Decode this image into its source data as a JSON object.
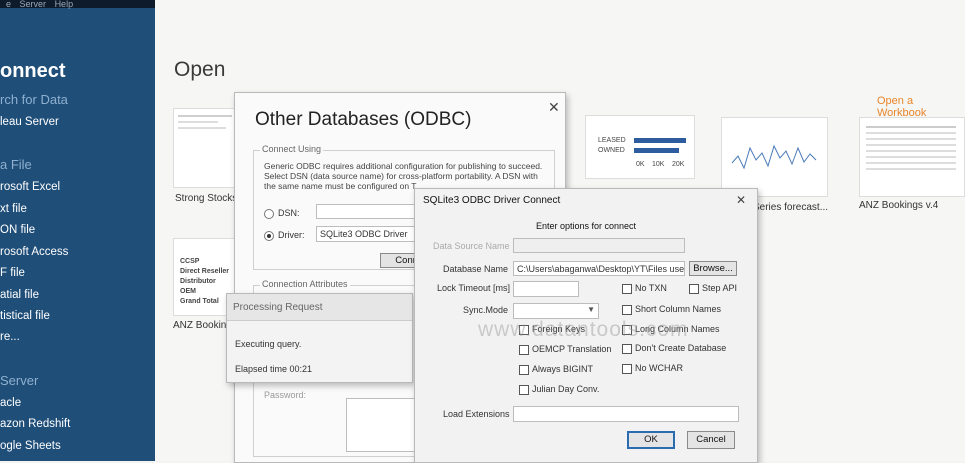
{
  "menubar": {
    "items": [
      "e",
      "Server",
      "Help"
    ]
  },
  "sidebar": {
    "title": "onnect",
    "search_label": "rch for Data",
    "tableau_server": "leau Server",
    "file_head": "a File",
    "file_items": [
      "rosoft Excel",
      "xt file",
      "ON file",
      "rosoft Access",
      "F file",
      "atial file",
      "tistical file",
      "re..."
    ],
    "server_head": "Server",
    "server_items": [
      "acle",
      "azon Redshift",
      "ogle Sheets"
    ]
  },
  "main": {
    "open_title": "Open",
    "open_workbook": "Open a Workbook",
    "thumbs": [
      {
        "label": "Strong Stocks"
      },
      {
        "label": "ANZ Bookin"
      },
      {
        "label": "Series forecast..."
      },
      {
        "label": "ANZ Bookings v.4"
      }
    ],
    "anz_rows": [
      "CCSP",
      "Direct Reseller",
      "Distributor",
      "OEM",
      "Grand Total"
    ],
    "bar_thumb": {
      "labels": [
        "LEASED",
        "OWNED"
      ],
      "ticks": [
        "0K",
        "10K",
        "20K"
      ]
    }
  },
  "odbc": {
    "title": "Other Databases (ODBC)",
    "connect_using": "Connect Using",
    "desc": "Generic ODBC requires additional configuration for publishing to succeed. Select DSN (data source name) for cross-platform portability. A DSN with the same name must be configured on T",
    "dsn_label": "DSN:",
    "driver_label": "Driver:",
    "driver_value": "SQLite3 ODBC Driver",
    "connect_btn": "Connect",
    "conn_attr": "Connection Attributes",
    "password_label": "Password:"
  },
  "processing": {
    "title": "Processing Request",
    "executing": "Executing query.",
    "elapsed": "Elapsed time 00:21"
  },
  "sqlite": {
    "title": "SQLite3 ODBC Driver Connect",
    "subtitle": "Enter options for connect",
    "ds_name_label": "Data Source Name",
    "db_name_label": "Database Name",
    "db_name_value": "C:\\Users\\abaganwa\\Desktop\\YT\\Files use",
    "browse": "Browse...",
    "lock_timeout_label": "Lock Timeout [ms]",
    "sync_mode_label": "Sync.Mode",
    "load_ext_label": "Load Extensions",
    "checks_left": [
      "Foreign Keys",
      "OEMCP Translation",
      "Always BIGINT",
      "Julian Day Conv."
    ],
    "checks_mid": [
      "No TXN",
      "Short Column Names",
      "Long Column Names",
      "Don't Create Database",
      "No WCHAR"
    ],
    "check_step": "Step API",
    "ok": "OK",
    "cancel": "Cancel"
  },
  "watermark": "www.datantools.com"
}
